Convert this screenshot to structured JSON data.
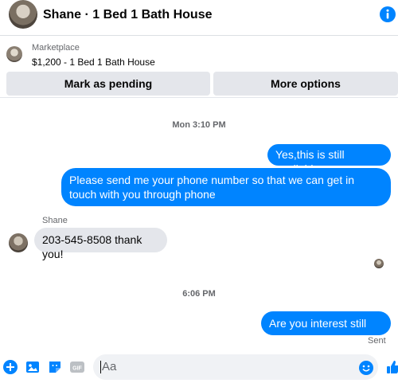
{
  "header": {
    "title": "Shane · 1 Bed 1 Bath House",
    "info_icon": "info-icon"
  },
  "listing": {
    "kind": "Marketplace",
    "price_title": "$1,200 - 1 Bed 1 Bath House",
    "mark_pending_label": "Mark as pending",
    "more_options_label": "More options"
  },
  "conversation": {
    "timestamp_1": "Mon 3:10 PM",
    "msg_1": "Yes,this is still available",
    "msg_2": "Please send me your phone  number so that we can get in touch with you through phone",
    "sender_name": "Shane",
    "msg_3": "203-545-8508 thank you!",
    "timestamp_2": "6:06 PM",
    "msg_4": "Are you interest still now",
    "status": "Sent"
  },
  "composer": {
    "placeholder": "Aa",
    "icons": [
      "plus-circle-icon",
      "photo-icon",
      "sticker-icon",
      "gif-icon",
      "emoji-icon",
      "thumbs-up-icon"
    ]
  },
  "colors": {
    "accent": "#0084ff",
    "incoming_bubble": "#e4e6eb",
    "muted_text": "#65676b"
  }
}
